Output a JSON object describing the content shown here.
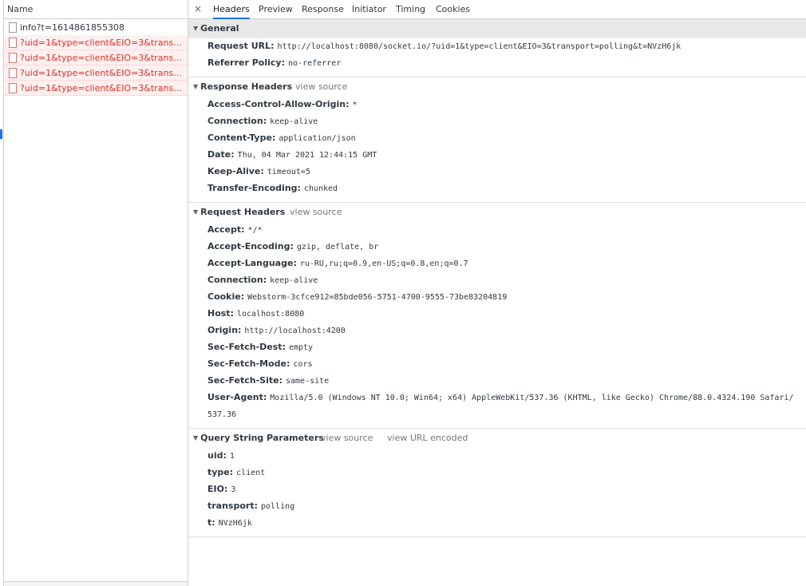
{
  "list": {
    "header": "Name",
    "requests": [
      {
        "name": "info?t=1614861855308",
        "status": "ok"
      },
      {
        "name": "?uid=1&type=client&EIO=3&transport=...",
        "status": "error"
      },
      {
        "name": "?uid=1&type=client&EIO=3&transport=...",
        "status": "error"
      },
      {
        "name": "?uid=1&type=client&EIO=3&transport=...",
        "status": "error"
      },
      {
        "name": "?uid=1&type=client&EIO=3&transport=...",
        "status": "error"
      }
    ]
  },
  "tabs": {
    "close": "×",
    "items": [
      "Headers",
      "Preview",
      "Response",
      "Initiator",
      "Timing",
      "Cookies"
    ],
    "active": "Headers"
  },
  "general": {
    "title": "General",
    "rows": [
      {
        "k": "Request URL:",
        "v": "http://localhost:8080/socket.io/?uid=1&type=client&EIO=3&transport=polling&t=NVzH6jk"
      },
      {
        "k": "Referrer Policy:",
        "v": "no-referrer"
      }
    ]
  },
  "response_headers": {
    "title": "Response Headers",
    "view_source": "view source",
    "rows": [
      {
        "k": "Access-Control-Allow-Origin:",
        "v": "*"
      },
      {
        "k": "Connection:",
        "v": "keep-alive"
      },
      {
        "k": "Content-Type:",
        "v": "application/json"
      },
      {
        "k": "Date:",
        "v": "Thu, 04 Mar 2021 12:44:15 GMT"
      },
      {
        "k": "Keep-Alive:",
        "v": "timeout=5"
      },
      {
        "k": "Transfer-Encoding:",
        "v": "chunked"
      }
    ]
  },
  "request_headers": {
    "title": "Request Headers",
    "view_source": "view source",
    "rows": [
      {
        "k": "Accept:",
        "v": "*/*"
      },
      {
        "k": "Accept-Encoding:",
        "v": "gzip, deflate, br"
      },
      {
        "k": "Accept-Language:",
        "v": "ru-RU,ru;q=0.9,en-US;q=0.8,en;q=0.7"
      },
      {
        "k": "Connection:",
        "v": "keep-alive"
      },
      {
        "k": "Cookie:",
        "v": "Webstorm-3cfce912=85bde056-5751-4700-9555-73be83204819"
      },
      {
        "k": "Host:",
        "v": "localhost:8080"
      },
      {
        "k": "Origin:",
        "v": "http://localhost:4200"
      },
      {
        "k": "Sec-Fetch-Dest:",
        "v": "empty"
      },
      {
        "k": "Sec-Fetch-Mode:",
        "v": "cors"
      },
      {
        "k": "Sec-Fetch-Site:",
        "v": "same-site"
      },
      {
        "k": "User-Agent:",
        "v": "Mozilla/5.0 (Windows NT 10.0; Win64; x64) AppleWebKit/537.36 (KHTML, like Gecko) Chrome/88.0.4324.190 Safari/537.36"
      }
    ]
  },
  "query_params": {
    "title": "Query String Parameters",
    "view_source": "view source",
    "view_url_encoded": "view URL encoded",
    "rows": [
      {
        "k": "uid:",
        "v": "1"
      },
      {
        "k": "type:",
        "v": "client"
      },
      {
        "k": "EIO:",
        "v": "3"
      },
      {
        "k": "transport:",
        "v": "polling"
      },
      {
        "k": "t:",
        "v": "NVzH6jk"
      }
    ]
  },
  "colors": {
    "accent": "#1a73e8",
    "error_text": "#d93025",
    "error_bg": "#fff0f0"
  }
}
